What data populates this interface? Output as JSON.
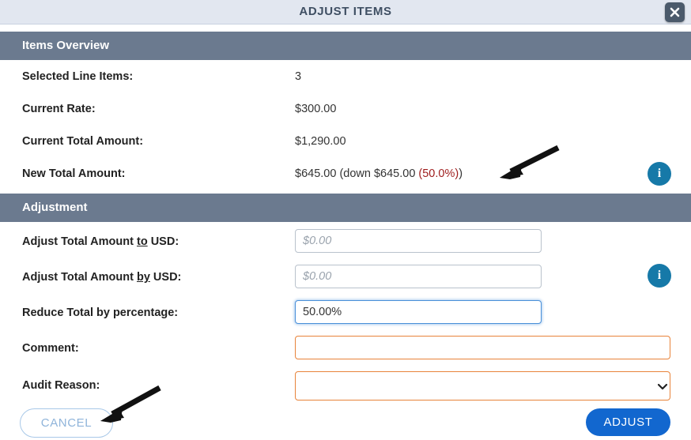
{
  "dialog": {
    "title": "ADJUST ITEMS",
    "close_icon": "close-icon"
  },
  "items_overview": {
    "section_title": "Items Overview",
    "rows": [
      {
        "label": "Selected Line Items:",
        "value": "3"
      },
      {
        "label": "Current Rate:",
        "value": "$300.00"
      },
      {
        "label": "Current Total Amount:",
        "value": "$1,290.00"
      }
    ],
    "new_total": {
      "label": "New Total Amount:",
      "value_prefix": "$645.00 (down $645.00 ",
      "percent": "(50.0%)",
      "value_suffix": ")",
      "percent_color": "#9e1b1b"
    },
    "info_icon": "info-icon"
  },
  "adjustment": {
    "section_title": "Adjustment",
    "fields": [
      {
        "label_before": "Adjust Total Amount ",
        "label_accesskey": "to",
        "label_after": " USD:",
        "placeholder": "$0.00",
        "value": ""
      },
      {
        "label_before": "Adjust Total Amount ",
        "label_accesskey": "by",
        "label_after": " USD:",
        "placeholder": "$0.00",
        "value": ""
      }
    ],
    "reduce_percentage": {
      "label": "Reduce Total by percentage:",
      "value": "50.00%",
      "placeholder": ""
    },
    "comment": {
      "label": "Comment:",
      "value": "",
      "placeholder": ""
    },
    "audit_reason": {
      "label": "Audit Reason:",
      "selected": "",
      "options": [
        ""
      ],
      "chevron_icon": "chevron-down-icon"
    },
    "info_icon": "info-icon"
  },
  "footer": {
    "cancel_label": "CANCEL",
    "adjust_label": "ADJUST"
  },
  "colors": {
    "title_bar": "#e2e7f0",
    "section_bar": "#6b7a8f",
    "info_blue": "#1679a8",
    "required_orange": "#e8833a",
    "focus_blue": "#4a90d9",
    "primary_blue": "#1267cf",
    "decrease_red": "#9e1b1b"
  }
}
